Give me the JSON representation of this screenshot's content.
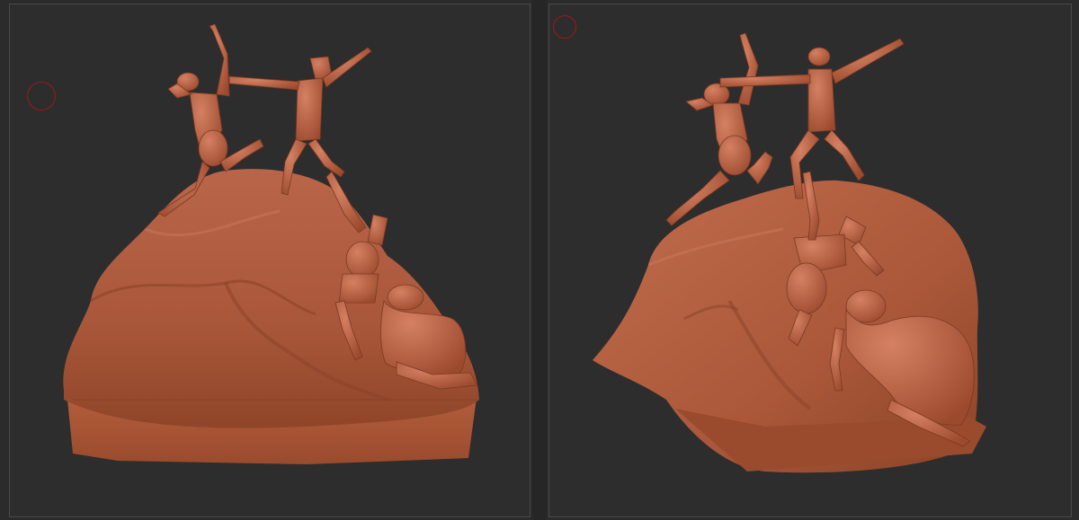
{
  "app": {
    "description_text": ""
  },
  "viewports": [
    {
      "id": "left",
      "view": "front-left",
      "brush_cursor": "brush-circle-icon"
    },
    {
      "id": "right",
      "view": "front-right",
      "brush_cursor": "brush-circle-icon"
    }
  ],
  "colors": {
    "background": "#2d2d2d",
    "viewport_border": "#4a4a4a",
    "clay": "#b5603f",
    "clay_highlight": "#d07a57",
    "clay_shadow": "#7d3b24",
    "brush_cursor": "#a01818"
  }
}
